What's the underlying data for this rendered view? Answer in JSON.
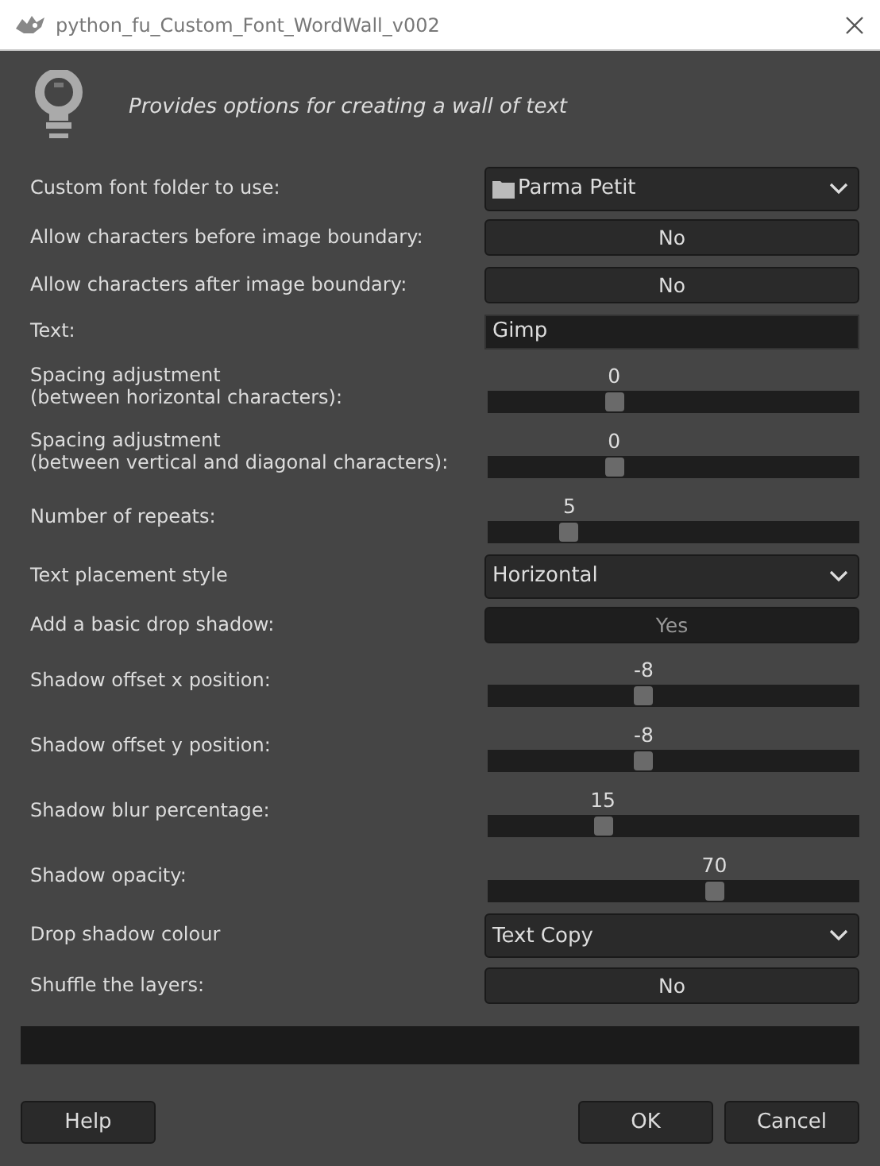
{
  "window": {
    "title": "python_fu_Custom_Font_WordWall_v002"
  },
  "description": "Provides options for creating a wall of text",
  "options": [
    {
      "kind": "dropdown",
      "label": "Custom font folder to use:",
      "value": "Parma Petit",
      "folder": true
    },
    {
      "kind": "toggle",
      "label": "Allow characters before image boundary:",
      "value": "No",
      "on": false
    },
    {
      "kind": "toggle",
      "label": "Allow characters after image boundary:",
      "value": "No",
      "on": false
    },
    {
      "kind": "text",
      "label": "Text:",
      "value": "Gimp"
    },
    {
      "kind": "slider",
      "label": "Spacing adjustment\n(between horizontal characters):",
      "reading": "0",
      "level": 0.34
    },
    {
      "kind": "slider",
      "label": "Spacing adjustment\n(between vertical and diagonal characters):",
      "reading": "0",
      "level": 0.34
    },
    {
      "kind": "slider",
      "label": "Number of repeats:",
      "reading": "5",
      "level": 0.22
    },
    {
      "kind": "dropdown",
      "label": "Text placement style",
      "value": "Horizontal",
      "folder": false
    },
    {
      "kind": "toggle",
      "label": "Add a basic drop shadow:",
      "value": "Yes",
      "on": true
    },
    {
      "kind": "slider",
      "label": "Shadow offset x position:",
      "reading": "-8",
      "level": 0.42
    },
    {
      "kind": "slider",
      "label": "Shadow offset y position:",
      "reading": "-8",
      "level": 0.42
    },
    {
      "kind": "slider",
      "label": "Shadow blur percentage:",
      "reading": "15",
      "level": 0.31
    },
    {
      "kind": "slider",
      "label": "Shadow opacity:",
      "reading": "70",
      "level": 0.61
    },
    {
      "kind": "dropdown",
      "label": "Drop shadow colour",
      "value": "Text Copy",
      "folder": false
    },
    {
      "kind": "toggle",
      "label": "Shuffle the layers:",
      "value": "No",
      "on": false
    }
  ],
  "buttons_left": [
    "Help"
  ],
  "buttons_right": [
    "OK",
    "Cancel"
  ]
}
